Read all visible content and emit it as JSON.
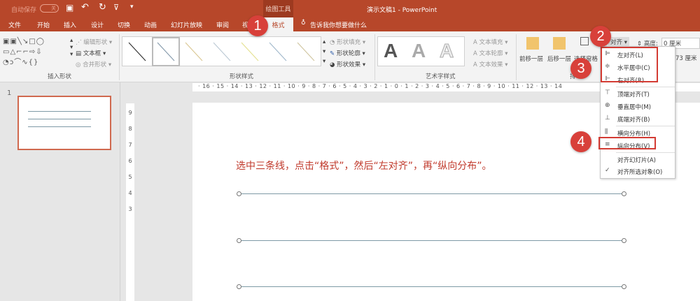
{
  "titlebar": {
    "autosave": "自动保存",
    "autosave_state": "关",
    "contextual_group": "绘图工具",
    "doc_title": "演示文稿1 - PowerPoint"
  },
  "tabs": [
    "文件",
    "开始",
    "插入",
    "设计",
    "切换",
    "动画",
    "幻灯片放映",
    "审阅",
    "视",
    "格式"
  ],
  "tell_me": "告诉我你想要做什么",
  "ribbon": {
    "insert_shapes": {
      "label": "插入形状",
      "edit_shape": "编辑形状",
      "text_box": "文本框",
      "merge_shapes": "合并形状"
    },
    "shape_styles": {
      "label": "形状样式",
      "fill": "形状填充",
      "outline": "形状轮廓",
      "effects": "形状效果"
    },
    "wordart": {
      "label": "艺术字样式",
      "letter": "A",
      "text_fill": "文本填充",
      "text_outline": "文本轮廓",
      "text_effects": "文本效果"
    },
    "arrange": {
      "bring_forward": "前移一层",
      "send_backward": "后移一层",
      "selection_pane": "选择窗格",
      "align": "对齐",
      "label": "排"
    },
    "size": {
      "height_label": "高度:",
      "height_value": "0 厘米",
      "width_value": "73 厘米"
    }
  },
  "align_menu": [
    {
      "icon": "align-left-icon",
      "glyph": "⊫",
      "label": "左对齐(L)"
    },
    {
      "icon": "align-center-icon",
      "glyph": "≑",
      "label": "水平居中(C)"
    },
    {
      "icon": "align-right-icon",
      "glyph": "⊩",
      "label": "右对齐(R)"
    },
    {
      "icon": "align-top-icon",
      "glyph": "⊤",
      "label": "顶端对齐(T)"
    },
    {
      "icon": "align-middle-icon",
      "glyph": "⊕",
      "label": "垂直居中(M)"
    },
    {
      "icon": "align-bottom-icon",
      "glyph": "⊥",
      "label": "底端对齐(B)"
    },
    {
      "icon": "distribute-horizontal-icon",
      "glyph": "⫼",
      "label": "横向分布(H)"
    },
    {
      "icon": "distribute-vertical-icon",
      "glyph": "≡",
      "label": "纵向分布(V)"
    },
    {
      "icon": "",
      "glyph": "",
      "label": "对齐幻灯片(A)"
    },
    {
      "icon": "check-icon",
      "glyph": "✓",
      "label": "对齐所选对象(O)"
    }
  ],
  "badges": [
    "1",
    "2",
    "3",
    "4"
  ],
  "slide_panel": {
    "number": "1"
  },
  "hruler": "· 16 · 15 · 14 · 13 · 12 · 11 · 10 · 9 · 8 · 7 · 6 · 5 · 4 · 3 · 2 · 1 · 0 · 1 · 2 · 3 · 4 · 5 · 6 · 7 · 8 · 9 · 10 · 11 · 12 · 13 · 14",
  "vruler": [
    "9",
    "8",
    "7",
    "6",
    "5",
    "4",
    "3"
  ],
  "slide": {
    "instruction": "选中三条线，点击“格式”，然后“左对齐”，再“纵向分布”。"
  },
  "colors": {
    "accent": "#b7472a",
    "badge": "#d8403a",
    "instruction": "#c0392b",
    "line": "#7e9aa6"
  }
}
